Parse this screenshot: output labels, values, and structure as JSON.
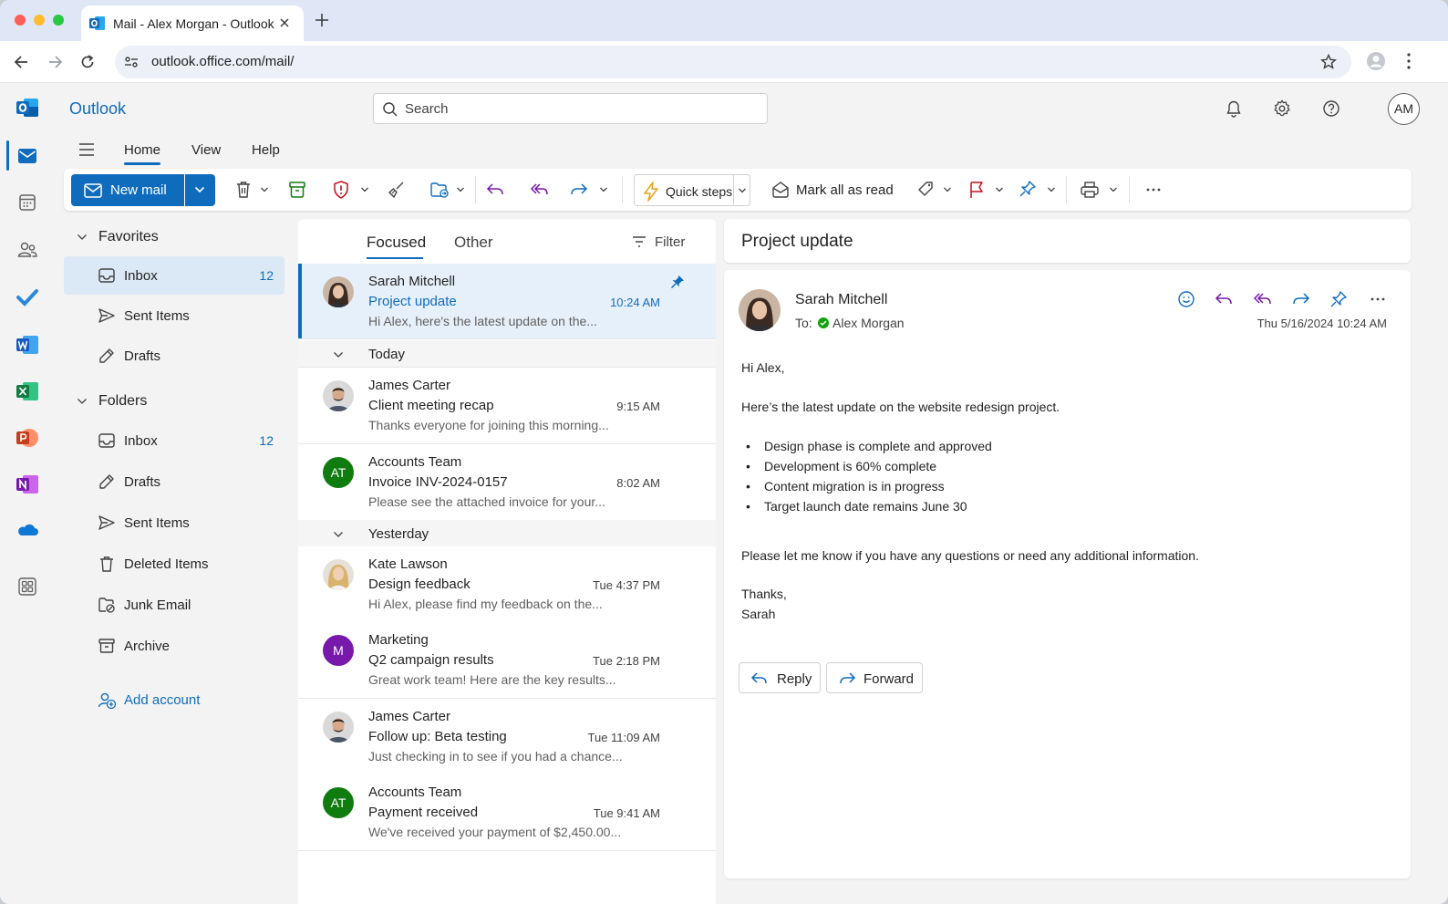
{
  "browser": {
    "tab_title": "Mail - Alex Morgan - Outlook",
    "url": "outlook.office.com/mail/"
  },
  "app": {
    "brand": "Outlook",
    "search_placeholder": "Search",
    "user_initials": "AM",
    "accent_color": "#0f6cbd"
  },
  "ribbon": {
    "tabs": [
      "Home",
      "View",
      "Help"
    ],
    "new_mail": "New mail",
    "quick_steps": "Quick steps",
    "mark_all_read": "Mark all as read"
  },
  "folders": {
    "favorites_header": "Favorites",
    "favorites": [
      {
        "label": "Inbox",
        "count": "12",
        "icon": "inbox-icon"
      },
      {
        "label": "Sent Items",
        "count": "",
        "icon": "send-icon"
      },
      {
        "label": "Drafts",
        "count": "",
        "icon": "pencil-icon"
      }
    ],
    "folders_header": "Folders",
    "items": [
      {
        "label": "Inbox",
        "count": "12",
        "icon": "inbox-icon"
      },
      {
        "label": "Drafts",
        "count": "",
        "icon": "pencil-icon"
      },
      {
        "label": "Sent Items",
        "count": "",
        "icon": "send-icon"
      },
      {
        "label": "Deleted Items",
        "count": "",
        "icon": "trash-icon"
      },
      {
        "label": "Junk Email",
        "count": "",
        "icon": "junk-icon"
      },
      {
        "label": "Archive",
        "count": "",
        "icon": "archive-icon"
      }
    ],
    "add_account": "Add account"
  },
  "list": {
    "tab_focused": "Focused",
    "tab_other": "Other",
    "filter": "Filter",
    "pinned": {
      "sender": "Sarah Mitchell",
      "subject": "Project update",
      "time": "10:24 AM",
      "preview": "Hi Alex, here's the latest update on the..."
    },
    "group_today": "Today",
    "today": [
      {
        "sender": "James Carter",
        "subject": "Client meeting recap",
        "time": "9:15 AM",
        "preview": "Thanks everyone for joining this morning...",
        "avatar": "photo-male-1"
      },
      {
        "sender": "Accounts Team",
        "subject": "Invoice INV-2024-0157",
        "time": "8:02 AM",
        "preview": "Please see the attached invoice for your...",
        "initials": "AT",
        "color": "#107c10"
      }
    ],
    "group_yesterday": "Yesterday",
    "yesterday": [
      {
        "sender": "Kate Lawson",
        "subject": "Design feedback",
        "time": "Tue 4:37 PM",
        "preview": "Hi Alex, please find my feedback on the...",
        "avatar": "photo-female-2"
      },
      {
        "sender": "Marketing",
        "subject": "Q2 campaign results",
        "time": "Tue 2:18 PM",
        "preview": "Great work team! Here are the key results...",
        "initials": "M",
        "color": "#7719aa"
      },
      {
        "sender": "James Carter",
        "subject": "Follow up: Beta testing",
        "time": "Tue 11:09 AM",
        "preview": "Just checking in to see if you had a chance...",
        "avatar": "photo-male-1"
      },
      {
        "sender": "Accounts Team",
        "subject": "Payment received",
        "time": "Tue 9:41 AM",
        "preview": "We've received your payment of $2,450.00...",
        "initials": "AT",
        "color": "#107c10"
      }
    ]
  },
  "reading": {
    "title": "Project update",
    "sender": "Sarah Mitchell",
    "to_label": "To:",
    "to_name": "Alex Morgan",
    "date": "Thu 5/16/2024 10:24 AM",
    "greeting": "Hi Alex,",
    "intro": "Here’s the latest update on the website redesign project.",
    "bullets": [
      "Design phase is complete and approved",
      "Development is 60% complete",
      "Content migration is in progress",
      "Target launch date remains June 30"
    ],
    "closing": "Please let me know if you have any questions or need any additional information.",
    "signoff": "Thanks,",
    "signature": "Sarah",
    "reply": "Reply",
    "forward": "Forward"
  }
}
